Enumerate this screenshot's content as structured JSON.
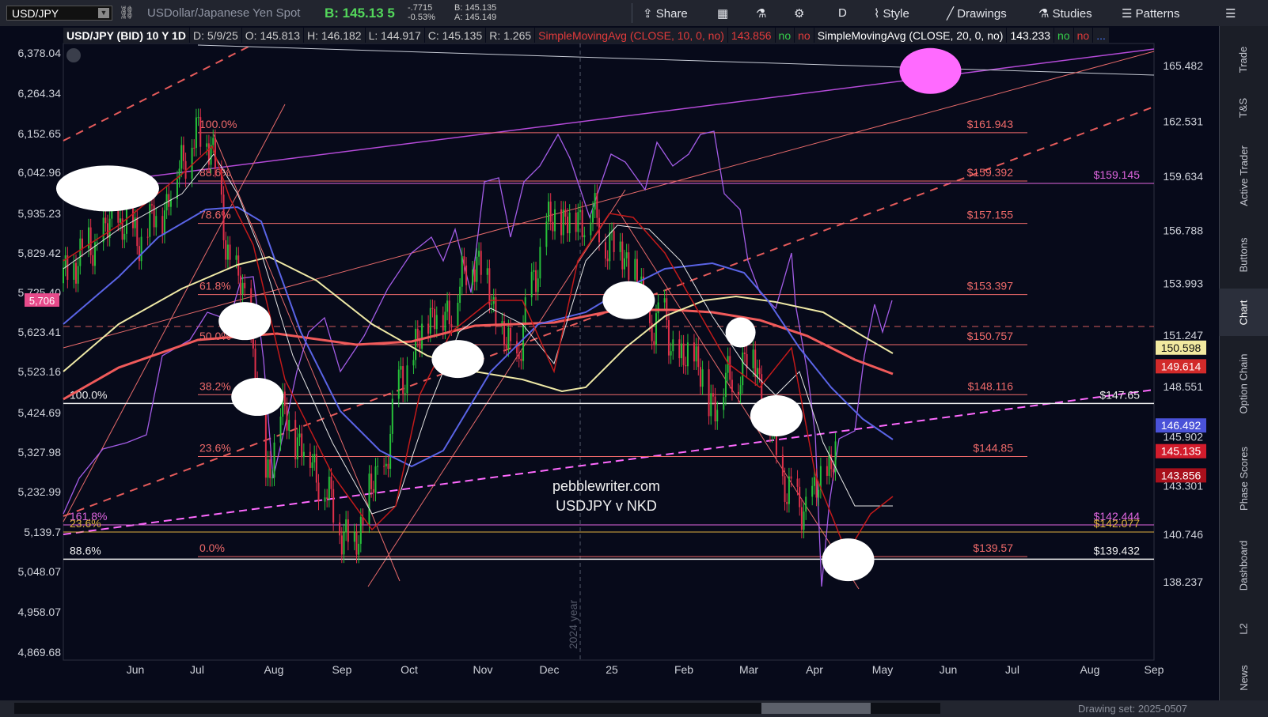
{
  "toolbar": {
    "symbol": "USD/JPY",
    "description": "USDollar/Japanese Yen Spot",
    "bid": "B: 145.13 5",
    "change": "-.7715",
    "change_pct": "-0.53%",
    "bid_small": "B: 145.135",
    "ask_small": "A: 145.149",
    "share_label": "Share",
    "period_label": "D",
    "style_label": "Style",
    "drawings_label": "Drawings",
    "studies_label": "Studies",
    "patterns_label": "Patterns"
  },
  "info_bar": {
    "title": "USD/JPY (BID) 10 Y 1D",
    "date": "D: 5/9/25",
    "open": "O: 145.813",
    "high": "H: 146.182",
    "low": "L: 144.917",
    "close": "C: 145.135",
    "range": "R: 1.265",
    "sma10": "SimpleMovingAvg (CLOSE, 10, 0, no)",
    "sma10_val": "143.856",
    "sma20": "SimpleMovingAvg (CLOSE, 20, 0, no)",
    "sma20_val": "143.233",
    "no": "no",
    "more": "..."
  },
  "side_tabs": [
    "Trade",
    "T&S",
    "Active Trader",
    "Buttons",
    "Chart",
    "Option Chain",
    "Phase Scores",
    "Dashboard",
    "L2",
    "News"
  ],
  "watermark": {
    "line1": "pebblewriter.com",
    "line2": "USDJPY v NKD"
  },
  "year_marker": "2024 year",
  "drawing_set": "Drawing set: 2025-0507",
  "colors": {
    "bg": "#070a1a",
    "candle_up": "#27c13a",
    "candle_down": "#e0304a",
    "fib": "#f06a6a",
    "nkd": "#a35ce6",
    "sma200": "#f05a5a",
    "sma100": "#efe9a6",
    "sma50": "#5a64e6"
  },
  "chart_data": {
    "type": "candlestick",
    "x_labels": [
      "Jun",
      "Jul",
      "Aug",
      "Sep",
      "Oct",
      "Nov",
      "Dec",
      "25",
      "Feb",
      "Mar",
      "Apr",
      "May",
      "Jun",
      "Jul",
      "Aug",
      "Sep"
    ],
    "x_range": [
      "2024-05-01",
      "2025-09-30"
    ],
    "y_right": {
      "ticks": [
        165.482,
        162.531,
        159.634,
        156.788,
        153.993,
        151.247,
        148.551,
        145.902,
        143.301,
        140.746,
        138.237
      ],
      "range": [
        135.5,
        167.3
      ]
    },
    "y_left": {
      "ticks": [
        "6,378.04",
        "6,264.34",
        "6,152.65",
        "6,042.96",
        "5,935.23",
        "5,829.42",
        "5,725.40",
        "5,623.41",
        "5,523.16",
        "5,424.69",
        "5,327.98",
        "5,232.99",
        "5,139.7",
        "5,048.07",
        "4,958.07",
        "4,869.68"
      ],
      "label": "NKD"
    },
    "fib_retracement": [
      {
        "pct": "100.0%",
        "price": "$161.943",
        "value": 161.943
      },
      {
        "pct": "88.6%",
        "price": "$159.392",
        "value": 159.392
      },
      {
        "pct": "78.6%",
        "price": "$157.155",
        "value": 157.155
      },
      {
        "pct": "61.8%",
        "price": "$153.397",
        "value": 153.397
      },
      {
        "pct": "50.0%",
        "price": "$150.757",
        "value": 150.757
      },
      {
        "pct": "38.2%",
        "price": "$148.116",
        "value": 148.116
      },
      {
        "pct": "23.6%",
        "price": "$144.85",
        "value": 144.85
      },
      {
        "pct": "0.0%",
        "price": "$139.57",
        "value": 139.57
      }
    ],
    "white_levels": [
      {
        "pct": "100.0%",
        "price": "$147.65",
        "value": 147.65
      },
      {
        "pct": "88.6%",
        "price": "$139.432",
        "value": 139.432
      }
    ],
    "other_levels": [
      {
        "pct": "161.8%",
        "price": "$142.444",
        "value": 142.444,
        "color": "#e066e0"
      },
      {
        "pct": "23.6%",
        "price": "$142.077",
        "value": 142.077,
        "color": "#e0b040"
      },
      {
        "pct": "",
        "price": "$159.145",
        "value": 159.145,
        "color": "#e066e0"
      }
    ],
    "price_badges": [
      {
        "text": "150.598",
        "value": 150.598,
        "bg": "#f2e9a0",
        "fg": "#111"
      },
      {
        "text": "149.614",
        "value": 149.614,
        "bg": "#d22a2a",
        "fg": "#fff"
      },
      {
        "text": "146.492",
        "value": 146.492,
        "bg": "#4a52d8",
        "fg": "#fff"
      },
      {
        "text": "145.135",
        "value": 145.135,
        "bg": "#d21c2c",
        "fg": "#fff"
      },
      {
        "text": "143.856",
        "value": 143.856,
        "bg": "#a8101c",
        "fg": "#fff"
      }
    ],
    "left_badge": {
      "text": "5,706"
    },
    "close_series": [
      [
        "2024-05-01",
        154.0
      ],
      [
        "2024-05-08",
        155.5
      ],
      [
        "2024-05-15",
        155.8
      ],
      [
        "2024-05-22",
        156.8
      ],
      [
        "2024-05-29",
        157.3
      ],
      [
        "2024-06-05",
        156.3
      ],
      [
        "2024-06-12",
        157.2
      ],
      [
        "2024-06-19",
        158.2
      ],
      [
        "2024-06-26",
        160.6
      ],
      [
        "2024-07-03",
        161.7
      ],
      [
        "2024-07-10",
        161.6
      ],
      [
        "2024-07-17",
        156.0
      ],
      [
        "2024-07-24",
        153.8
      ],
      [
        "2024-07-31",
        150.0
      ],
      [
        "2024-08-05",
        143.2
      ],
      [
        "2024-08-12",
        147.2
      ],
      [
        "2024-08-19",
        146.0
      ],
      [
        "2024-08-26",
        144.8
      ],
      [
        "2024-09-02",
        143.1
      ],
      [
        "2024-09-09",
        141.2
      ],
      [
        "2024-09-16",
        140.0
      ],
      [
        "2024-09-23",
        142.9
      ],
      [
        "2024-09-30",
        144.0
      ],
      [
        "2024-10-07",
        148.7
      ],
      [
        "2024-10-14",
        149.9
      ],
      [
        "2024-10-21",
        152.5
      ],
      [
        "2024-10-28",
        152.1
      ],
      [
        "2024-11-04",
        153.5
      ],
      [
        "2024-11-11",
        155.5
      ],
      [
        "2024-11-18",
        154.2
      ],
      [
        "2024-11-25",
        151.0
      ],
      [
        "2024-12-02",
        149.9
      ],
      [
        "2024-12-09",
        153.7
      ],
      [
        "2024-12-16",
        156.9
      ],
      [
        "2024-12-23",
        157.5
      ],
      [
        "2024-12-30",
        157.3
      ],
      [
        "2025-01-06",
        157.8
      ],
      [
        "2025-01-13",
        156.3
      ],
      [
        "2025-01-20",
        155.9
      ],
      [
        "2025-01-27",
        154.4
      ],
      [
        "2025-02-03",
        151.5
      ],
      [
        "2025-02-10",
        152.2
      ],
      [
        "2025-02-17",
        149.4
      ],
      [
        "2025-02-24",
        150.6
      ],
      [
        "2025-03-03",
        147.5
      ],
      [
        "2025-03-10",
        148.6
      ],
      [
        "2025-03-17",
        149.3
      ],
      [
        "2025-03-24",
        150.5
      ],
      [
        "2025-03-31",
        146.9
      ],
      [
        "2025-04-07",
        143.5
      ],
      [
        "2025-04-14",
        142.2
      ],
      [
        "2025-04-21",
        142.4
      ],
      [
        "2025-04-28",
        144.3
      ],
      [
        "2025-05-05",
        145.1
      ]
    ],
    "circles": [
      {
        "date": "2024-05-22",
        "value": 159.0,
        "w": 130,
        "h": 58,
        "color": "#ffffff"
      },
      {
        "date": "2024-07-26",
        "value": 152.0,
        "w": 66,
        "h": 48,
        "color": "#ffffff"
      },
      {
        "date": "2024-08-01",
        "value": 148.0,
        "w": 66,
        "h": 48,
        "color": "#ffffff"
      },
      {
        "date": "2024-11-04",
        "value": 150.0,
        "w": 66,
        "h": 48,
        "color": "#ffffff"
      },
      {
        "date": "2025-01-24",
        "value": 153.1,
        "w": 66,
        "h": 48,
        "color": "#ffffff"
      },
      {
        "date": "2025-03-18",
        "value": 151.4,
        "w": 38,
        "h": 38,
        "color": "#ffffff"
      },
      {
        "date": "2025-04-04",
        "value": 147.0,
        "w": 66,
        "h": 52,
        "color": "#ffffff"
      },
      {
        "date": "2025-05-08",
        "value": 139.4,
        "w": 66,
        "h": 54,
        "color": "#ffffff"
      },
      {
        "date": "2025-06-16",
        "value": 165.2,
        "w": 78,
        "h": 58,
        "color": "#ff6aff"
      }
    ]
  }
}
